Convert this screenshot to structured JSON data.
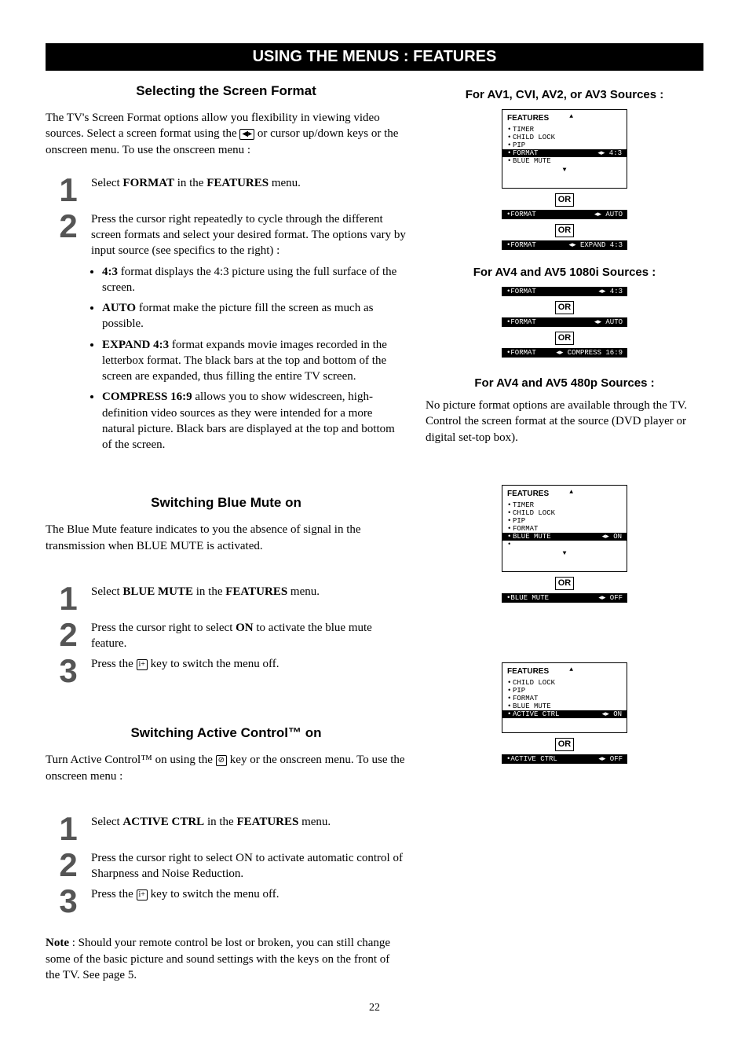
{
  "banner": "USING THE MENUS : FEATURES",
  "pageNumber": "22",
  "or": "OR",
  "left": {
    "sec1": {
      "title": "Selecting the Screen Format",
      "intro_a": "The TV's Screen Format options allow you flexibility in viewing video sources. Select a screen format using the ",
      "intro_b": " or cursor up/down keys or the onscreen menu. To use the onscreen menu :",
      "iconCursor": "◀▸",
      "step1_a": "Select ",
      "step1_b": "FORMAT",
      "step1_c": " in the ",
      "step1_d": "FEATURES",
      "step1_e": " menu.",
      "step2": "Press the cursor right repeatedly to cycle through the different screen formats and select your desired format. The options vary by input source (see specifics to the right) :",
      "b1_b": "4:3",
      "b1_t": " format displays the 4:3 picture using the full surface of the screen.",
      "b2_b": "AUTO",
      "b2_t": " format make the picture fill the screen as much as possible.",
      "b3_b": "EXPAND 4:3",
      "b3_t": " format expands movie images recorded in the letterbox format. The black bars at the top and bottom of the screen are expanded, thus filling the entire TV screen.",
      "b4_b": "COMPRESS 16:9",
      "b4_t": " allows you to show widescreen, high-definition video sources as they were intended for a more natural picture. Black bars are displayed at the top and bottom of the screen."
    },
    "sec2": {
      "title": "Switching Blue Mute on",
      "intro": "The Blue Mute feature indicates to you the absence of signal in the transmission when BLUE MUTE is activated.",
      "step1_a": "Select ",
      "step1_b": "BLUE MUTE",
      "step1_c": " in the ",
      "step1_d": "FEATURES",
      "step1_e": " menu.",
      "step2_a": "Press the cursor right to select ",
      "step2_b": "ON",
      "step2_c": " to activate the blue mute feature.",
      "step3_a": "Press the ",
      "step3_b": " key to switch the menu off.",
      "iconInfo": "i+"
    },
    "sec3": {
      "title": "Switching Active Control™ on",
      "intro_a": "Turn Active Control™ on using the ",
      "intro_b": " key or the onscreen menu. To use the onscreen menu :",
      "iconCtrl": "⊘",
      "step1_a": "Select ",
      "step1_b": "ACTIVE CTRL",
      "step1_c": " in the ",
      "step1_d": "FEATURES",
      "step1_e": " menu.",
      "step2": "Press the cursor right to select ON to activate automatic control of Sharpness and Noise Reduction.",
      "step3_a": "Press the ",
      "step3_b": " key to switch the menu off.",
      "iconInfo": "i+",
      "note_b": "Note",
      "note_t": " : Should your remote control be lost or broken, you can still change some of the basic picture and sound settings with the keys on the front of the TV. See page 5."
    }
  },
  "right": {
    "g1_title": "For AV1, CVI, AV2, or AV3 Sources :",
    "g2_title": "For AV4 and AV5 1080i Sources :",
    "g3_title": "For AV4 and AV5 480p Sources :",
    "g3_body": "No picture format options are available through the TV. Control the screen format at the source (DVD player or digital set-top box).",
    "features": "FEATURES",
    "m_timer": "TIMER",
    "m_childlock": "CHILD LOCK",
    "m_pip": "PIP",
    "m_format": "FORMAT",
    "m_bluemute": "BLUE MUTE",
    "m_activectrl": "ACTIVE CTRL",
    "v_43": "4:3",
    "v_auto": "AUTO",
    "v_expand": "EXPAND 4:3",
    "v_compress": "COMPRESS 16:9",
    "v_on": "ON",
    "v_off": "OFF",
    "arrow": "◂▸"
  }
}
